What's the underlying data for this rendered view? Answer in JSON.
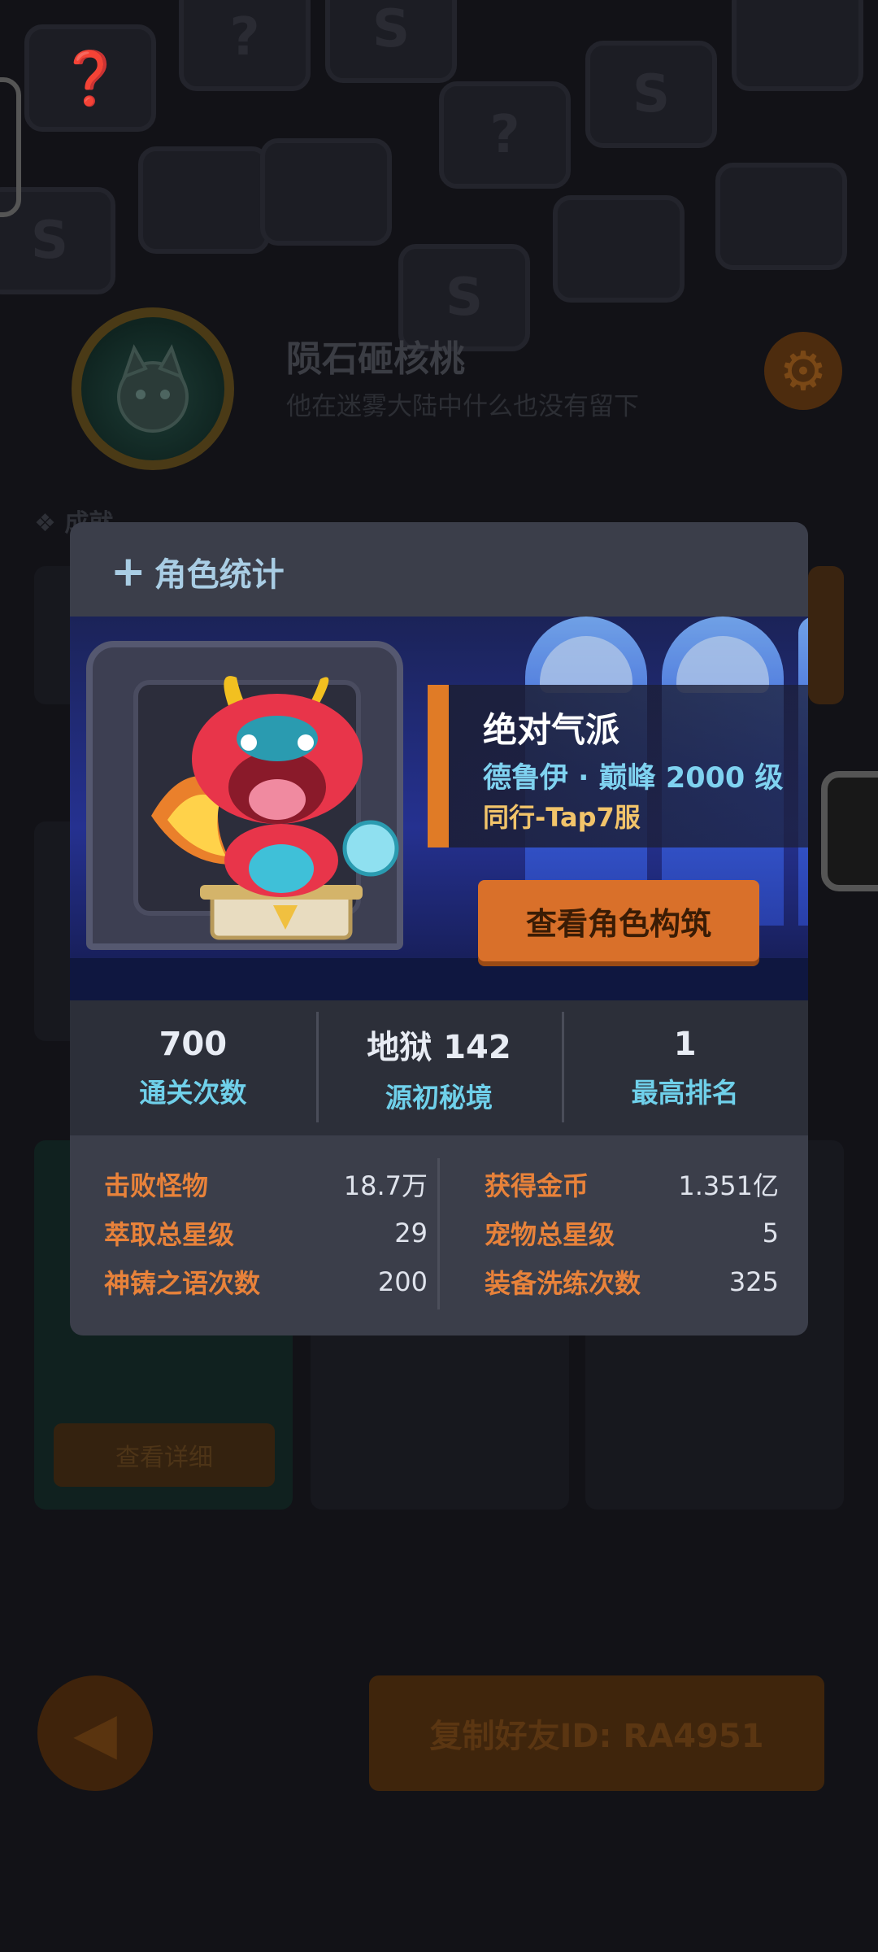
{
  "profile": {
    "name": "陨石砸核桃",
    "description": "他在迷雾大陆中什么也没有留下"
  },
  "background": {
    "section_achievements": "成就",
    "detail_button": "查看详细",
    "copy_friend_id": "复制好友ID: RA4951"
  },
  "modal": {
    "title": "角色统计",
    "character": {
      "name": "绝对气派",
      "class_level": "德鲁伊 · 巅峰 2000 级",
      "server": "同行-Tap7服"
    },
    "build_button": "查看角色构筑",
    "stats": [
      {
        "value": "700",
        "label": "通关次数"
      },
      {
        "value": "地狱 142",
        "label": "源初秘境"
      },
      {
        "value": "1",
        "label": "最高排名"
      }
    ],
    "details_left": [
      {
        "label": "击败怪物",
        "value": "18.7万"
      },
      {
        "label": "萃取总星级",
        "value": "29"
      },
      {
        "label": "神铸之语次数",
        "value": "200"
      }
    ],
    "details_right": [
      {
        "label": "获得金币",
        "value": "1.351亿"
      },
      {
        "label": "宠物总星级",
        "value": "5"
      },
      {
        "label": "装备洗练次数",
        "value": "325"
      }
    ]
  },
  "colors": {
    "accent_orange": "#d9702a",
    "label_cyan": "#6fd0ea",
    "detail_label": "#e8823a",
    "modal_bg": "#3b3e4a"
  }
}
